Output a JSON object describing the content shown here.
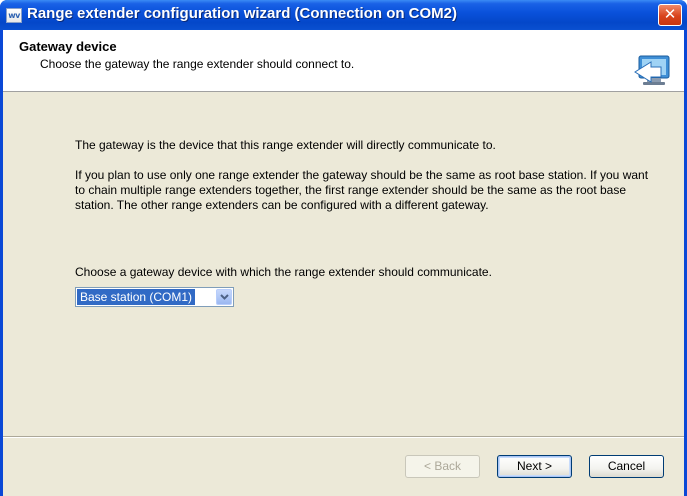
{
  "window": {
    "title": "Range extender configuration wizard (Connection on COM2)",
    "app_icon_text": "wv",
    "close_glyph": "✕"
  },
  "header": {
    "title": "Gateway device",
    "subtitle": "Choose the gateway the range extender should connect to.",
    "icon": "wizard-network-icon"
  },
  "content": {
    "intro": "The gateway is the device that this range extender will directly communicate to.",
    "explanation": "If you plan to use only one range extender the gateway should be the same as root base station. If you want to chain multiple range extenders together, the first range extender should be the same as the root base station. The other range extenders can be configured with a different gateway.",
    "prompt": "Choose a gateway device with which the range extender should communicate."
  },
  "gateway_select": {
    "selected": "Base station (COM1)"
  },
  "buttons": {
    "back": "< Back",
    "next": "Next >",
    "cancel": "Cancel"
  },
  "colors": {
    "titlebar": "#0a52dc",
    "client_bg": "#ece9d8",
    "selection": "#316ac5"
  }
}
